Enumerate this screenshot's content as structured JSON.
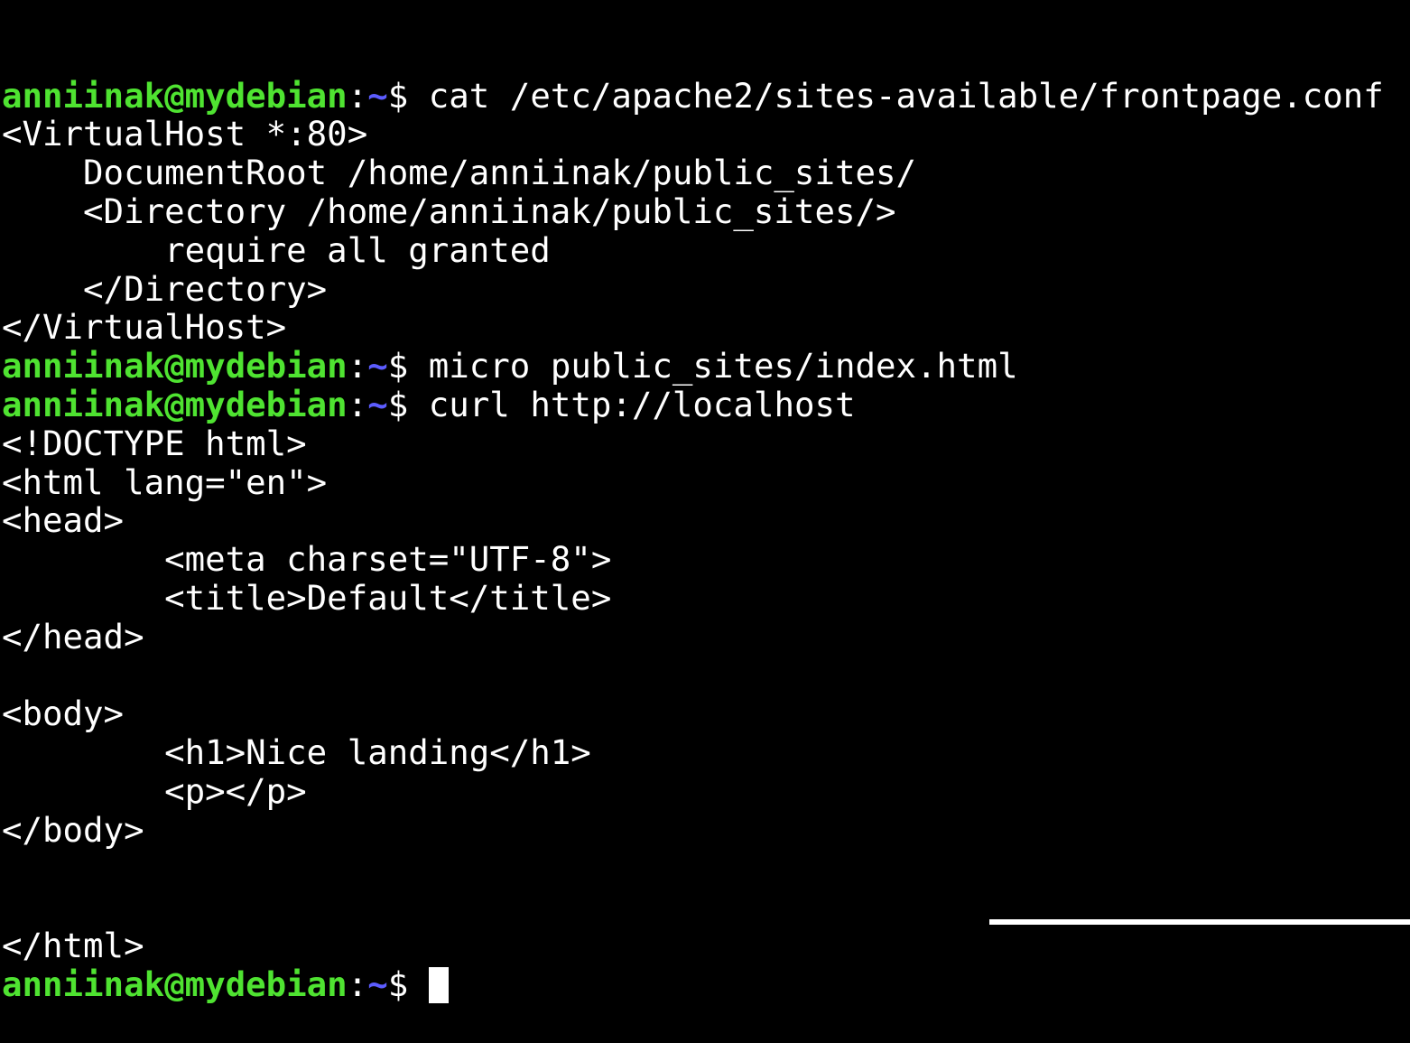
{
  "terminal": {
    "colors": {
      "background": "#000000",
      "text": "#ffffff",
      "user_host": "#4fe331",
      "cwd": "#5c5cff"
    },
    "prompt": {
      "user_host": "anniinak@mydebian",
      "colon": ":",
      "cwd": "~",
      "symbol": "$ "
    },
    "lines": [
      {
        "type": "prompt",
        "command": "cat /etc/apache2/sites-available/frontpage.conf"
      },
      {
        "type": "output",
        "text": "<VirtualHost *:80>"
      },
      {
        "type": "output",
        "text": "    DocumentRoot /home/anniinak/public_sites/"
      },
      {
        "type": "output",
        "text": "    <Directory /home/anniinak/public_sites/>"
      },
      {
        "type": "output",
        "text": "        require all granted"
      },
      {
        "type": "output",
        "text": "    </Directory>"
      },
      {
        "type": "output",
        "text": "</VirtualHost>"
      },
      {
        "type": "prompt",
        "command": "micro public_sites/index.html"
      },
      {
        "type": "prompt",
        "command": "curl http://localhost"
      },
      {
        "type": "output",
        "text": "<!DOCTYPE html>"
      },
      {
        "type": "output",
        "text": "<html lang=\"en\">"
      },
      {
        "type": "output",
        "text": "<head>"
      },
      {
        "type": "output",
        "text": "        <meta charset=\"UTF-8\">"
      },
      {
        "type": "output",
        "text": "        <title>Default</title>"
      },
      {
        "type": "output",
        "text": "</head>"
      },
      {
        "type": "output",
        "text": ""
      },
      {
        "type": "output",
        "text": "<body>"
      },
      {
        "type": "output",
        "text": "        <h1>Nice landing</h1>"
      },
      {
        "type": "output",
        "text": "        <p></p>"
      },
      {
        "type": "output",
        "text": "</body>"
      },
      {
        "type": "output",
        "text": ""
      },
      {
        "type": "output",
        "text": ""
      },
      {
        "type": "output",
        "text": "</html>"
      },
      {
        "type": "prompt",
        "command": "",
        "cursor": true
      }
    ]
  }
}
